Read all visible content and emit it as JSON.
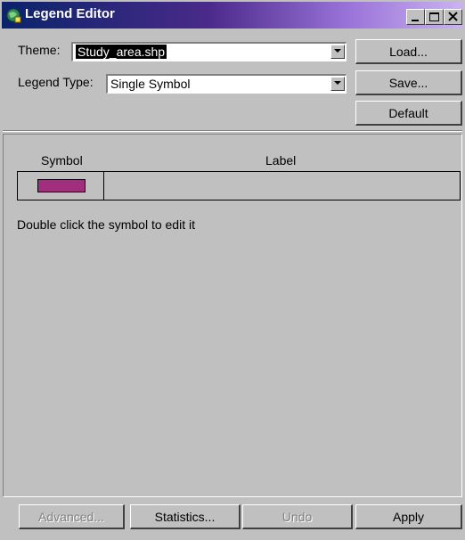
{
  "window": {
    "title": "Legend Editor",
    "icon": "globe-icon",
    "controls": [
      "minimize-icon",
      "maximize-icon",
      "close-icon"
    ]
  },
  "theme": {
    "label": "Theme:",
    "value": "Study_area.shp"
  },
  "legend_type": {
    "label": "Legend Type:",
    "value": "Single Symbol"
  },
  "side_buttons": {
    "load": "Load...",
    "save": "Save...",
    "default": "Default"
  },
  "table": {
    "columns": [
      "Symbol",
      "Label"
    ],
    "rows": [
      {
        "symbol_color": "#a0307d",
        "label": ""
      }
    ]
  },
  "hint": "Double click the symbol to edit it",
  "bottom_buttons": {
    "advanced": "Advanced...",
    "statistics": "Statistics...",
    "undo": "Undo",
    "apply": "Apply"
  },
  "colors": {
    "titlebar_start": "#0a246a",
    "titlebar_end": "#c9b4f0",
    "face": "#c0c0c0"
  }
}
